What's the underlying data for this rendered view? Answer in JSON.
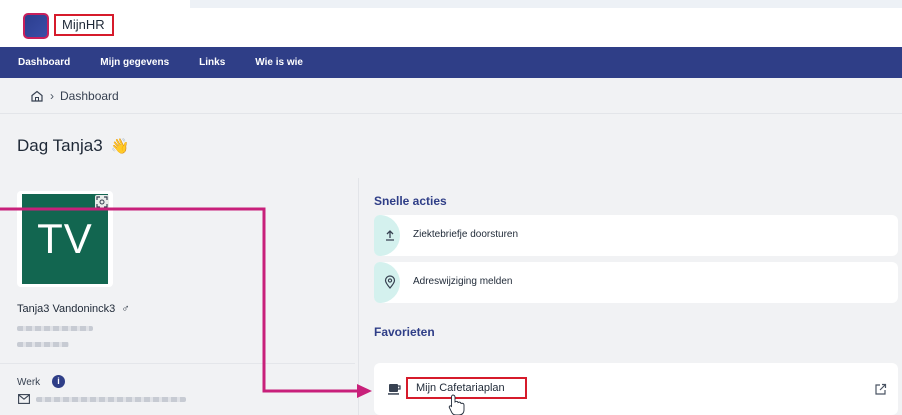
{
  "app": {
    "name": "MijnHR",
    "accent": "#2f3e87",
    "highlight": "#d61b2b",
    "annotation_arrow": "#c8207a"
  },
  "nav": {
    "items": [
      {
        "label": "Dashboard"
      },
      {
        "label": "Mijn gegevens"
      },
      {
        "label": "Links"
      },
      {
        "label": "Wie is wie"
      }
    ]
  },
  "breadcrumb": {
    "current": "Dashboard",
    "icon": "home-icon"
  },
  "greeting": {
    "text": "Dag Tanja3",
    "emoji": "👋"
  },
  "profile": {
    "initials": "TV",
    "avatar_color": "#126650",
    "name": "Tanja3 Vandoninck3",
    "gender_symbol": "♂",
    "work_label": "Werk",
    "info_icon": "i"
  },
  "quick_actions": {
    "title": "Snelle acties",
    "items": [
      {
        "label": "Ziektebriefje doorsturen",
        "icon": "upload-icon"
      },
      {
        "label": "Adreswijziging melden",
        "icon": "location-pin-icon"
      }
    ]
  },
  "favorites": {
    "title": "Favorieten",
    "items": [
      {
        "label": "Mijn Cafetariaplan",
        "icon": "coffee-cup-icon",
        "action_icon": "external-link-icon"
      }
    ]
  }
}
